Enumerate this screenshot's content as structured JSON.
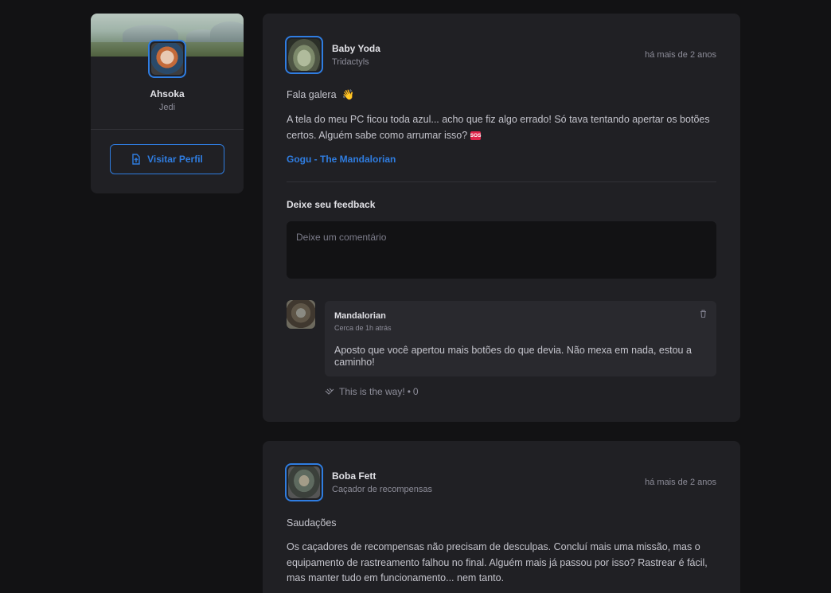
{
  "sidebar": {
    "name": "Ahsoka",
    "role": "Jedi",
    "visit_label": "Visitar Perfil"
  },
  "post1": {
    "author": "Baby Yoda",
    "role": "Tridactyls",
    "time": "há mais de 2 anos",
    "greeting": "Fala galera",
    "greeting_emoji": "👋",
    "body": "A tela do meu PC ficou toda azul... acho que fiz algo errado! Só tava tentando apertar os botões certos. Alguém sabe como arrumar isso?",
    "body_emoji": "SOS",
    "hashtag": "Gogu - The Mandalorian",
    "feedback_title": "Deixe seu feedback",
    "feedback_placeholder": "Deixe um comentário",
    "comment": {
      "author": "Mandalorian",
      "time": "Cerca de 1h atrás",
      "text": "Aposto que você apertou mais botões do que devia. Não mexa em nada, estou a caminho!",
      "applaud_label": "This is the way!",
      "applaud_separator": "•",
      "applaud_count": "0"
    }
  },
  "post2": {
    "author": "Boba Fett",
    "role": "Caçador de recompensas",
    "time": "há mais de 2 anos",
    "greeting": "Saudações",
    "body": "Os caçadores de recompensas não precisam de desculpas. Concluí mais uma missão, mas o equipamento de rastreamento falhou no final. Alguém mais já passou por isso? Rastrear é fácil, mas manter tudo em funcionamento... nem tanto."
  },
  "colors": {
    "accent": "#2f7de1",
    "background": "#121214",
    "card": "#202024"
  }
}
